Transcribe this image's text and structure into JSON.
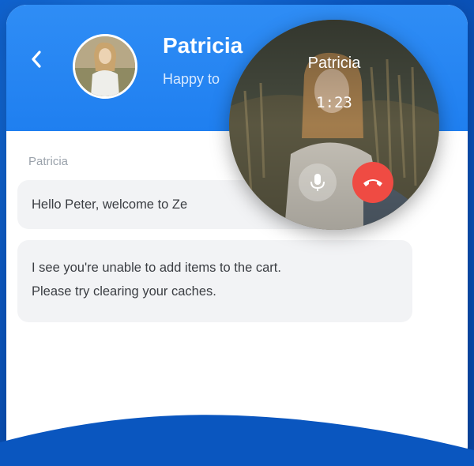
{
  "header": {
    "contact_name": "Patricia",
    "status_text": "Happy to"
  },
  "chat": {
    "sender_label": "Patricia",
    "messages": [
      {
        "text": "Hello Peter, welcome to Ze"
      },
      {
        "text_line1": "I see you're unable to add items to the cart.",
        "text_line2": "Please try clearing your caches."
      }
    ]
  },
  "call": {
    "caller_name": "Patricia",
    "timer": "1:23"
  },
  "colors": {
    "header_blue": "#1f7ff0",
    "end_call_red": "#ef4b43",
    "bubble_bg": "#f2f3f5"
  },
  "icons": {
    "back": "chevron-left-icon",
    "mic": "microphone-icon",
    "end": "phone-hangup-icon"
  }
}
